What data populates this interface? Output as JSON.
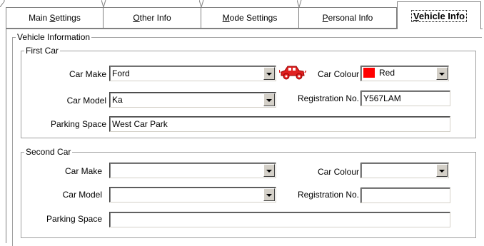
{
  "tabs": [
    {
      "id": "main",
      "prefix": "Main ",
      "accel": "S",
      "suffix": "ettings",
      "active": false
    },
    {
      "id": "other",
      "prefix": "",
      "accel": "O",
      "suffix": "ther Info",
      "active": false
    },
    {
      "id": "mode",
      "prefix": "",
      "accel": "M",
      "suffix": "ode Settings",
      "active": false
    },
    {
      "id": "personal",
      "prefix": "",
      "accel": "P",
      "suffix": "ersonal Info",
      "active": false
    },
    {
      "id": "vehicle",
      "prefix": "",
      "accel": "V",
      "suffix": "ehicle Info",
      "active": true
    }
  ],
  "vehicle_info": {
    "group_title": "Vehicle Information",
    "first_car": {
      "title": "First Car",
      "car_make_label": "Car Make",
      "car_make_value": "Ford",
      "car_model_label": "Car Model",
      "car_model_value": "Ka",
      "parking_space_label": "Parking Space",
      "parking_space_value": "West Car Park",
      "car_colour_label": "Car Colour",
      "car_colour_value": "Red",
      "car_colour_swatch": "#ff0000",
      "registration_label": "Registration No.",
      "registration_value": "Y567LAM",
      "car_icon": "car-icon",
      "car_icon_color": "#e02020"
    },
    "second_car": {
      "title": "Second Car",
      "car_make_label": "Car Make",
      "car_make_value": "",
      "car_model_label": "Car Model",
      "car_model_value": "",
      "parking_space_label": "Parking Space",
      "parking_space_value": "",
      "car_colour_label": "Car Colour",
      "car_colour_value": "",
      "registration_label": "Registration No.",
      "registration_value": ""
    }
  }
}
